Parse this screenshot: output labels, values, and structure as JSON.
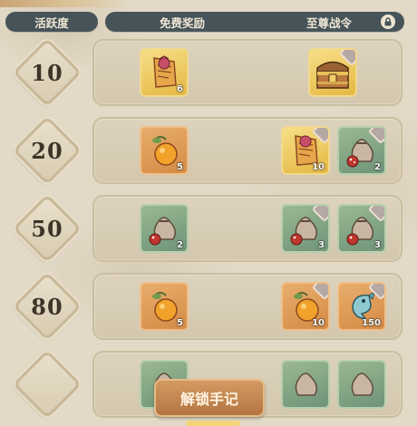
{
  "header": {
    "activity_label": "活跃度",
    "free_label": "免费奖励",
    "premium_label": "至尊战令"
  },
  "rows": [
    {
      "level": "10",
      "free": [
        {
          "icon": "scroll-icon",
          "qty": "6",
          "rarity": "gold"
        }
      ],
      "premium": [
        {
          "icon": "treasure-chest-icon",
          "qty": "",
          "rarity": "gold",
          "locked": true
        }
      ]
    },
    {
      "level": "20",
      "free": [
        {
          "icon": "orange-fruit-icon",
          "qty": "5",
          "rarity": "orange"
        }
      ],
      "premium": [
        {
          "icon": "scroll-icon",
          "qty": "10",
          "rarity": "gold",
          "locked": true
        },
        {
          "icon": "mushroom-sack-icon",
          "qty": "2",
          "rarity": "green",
          "locked": true
        }
      ]
    },
    {
      "level": "50",
      "free": [
        {
          "icon": "mushroom-sack-icon",
          "qty": "2",
          "rarity": "green"
        }
      ],
      "premium": [
        {
          "icon": "mushroom-sack-icon",
          "qty": "3",
          "rarity": "green",
          "locked": true
        },
        {
          "icon": "mushroom-sack-icon",
          "qty": "3",
          "rarity": "green",
          "locked": true
        }
      ]
    },
    {
      "level": "80",
      "free": [
        {
          "icon": "orange-fruit-icon",
          "qty": "5",
          "rarity": "orange"
        }
      ],
      "premium": [
        {
          "icon": "orange-fruit-icon",
          "qty": "10",
          "rarity": "orange",
          "locked": true
        },
        {
          "icon": "blue-fish-icon",
          "qty": "150",
          "rarity": "orange",
          "locked": true
        }
      ]
    },
    {
      "level": "",
      "free": [
        {
          "icon": "mushroom-sack-icon",
          "qty": "",
          "rarity": "green"
        }
      ],
      "premium": [
        {
          "icon": "mushroom-sack-icon",
          "qty": "",
          "rarity": "green"
        },
        {
          "icon": "mushroom-sack-icon",
          "qty": "",
          "rarity": "green"
        }
      ]
    }
  ],
  "unlock_button_label": "解锁手记"
}
